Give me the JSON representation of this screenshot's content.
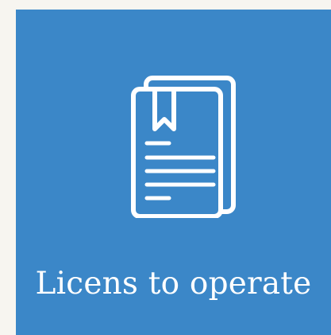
{
  "tile": {
    "label": "Licens to operate",
    "icon": "document-icon",
    "background_color": "#3b87c8"
  }
}
